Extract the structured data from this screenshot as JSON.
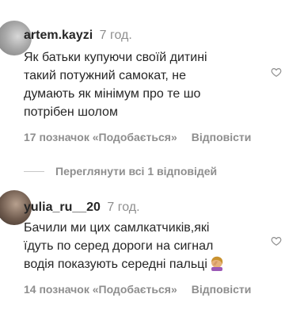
{
  "comments": [
    {
      "username": "artem.kayzi",
      "time": "7 год.",
      "text_lines": [
        "Як батьки купуючи своїй дитині",
        "такий потужний самокат, не",
        "думають як мінімум про те шо",
        "потрібен шолом"
      ],
      "likes": "17 позначок «Подобається»",
      "reply": "Відповісти"
    },
    {
      "username": "yulia_ru__20",
      "time": "7 год.",
      "text_lines": [
        "Бачили ми цих самлкатчиків,які",
        "їдуть по серед дороги на сигнал",
        "водія показують середні пальці"
      ],
      "emoji": "woman-facepalming",
      "likes": "14 позначок «Подобається»",
      "reply": "Відповісти"
    }
  ],
  "view_replies": "Переглянути всі 1 відповідей",
  "icons": {
    "like": "heart-outline-icon"
  },
  "colors": {
    "text": "#262626",
    "secondary": "#8e8e8e",
    "divider": "#c7c7c7"
  }
}
